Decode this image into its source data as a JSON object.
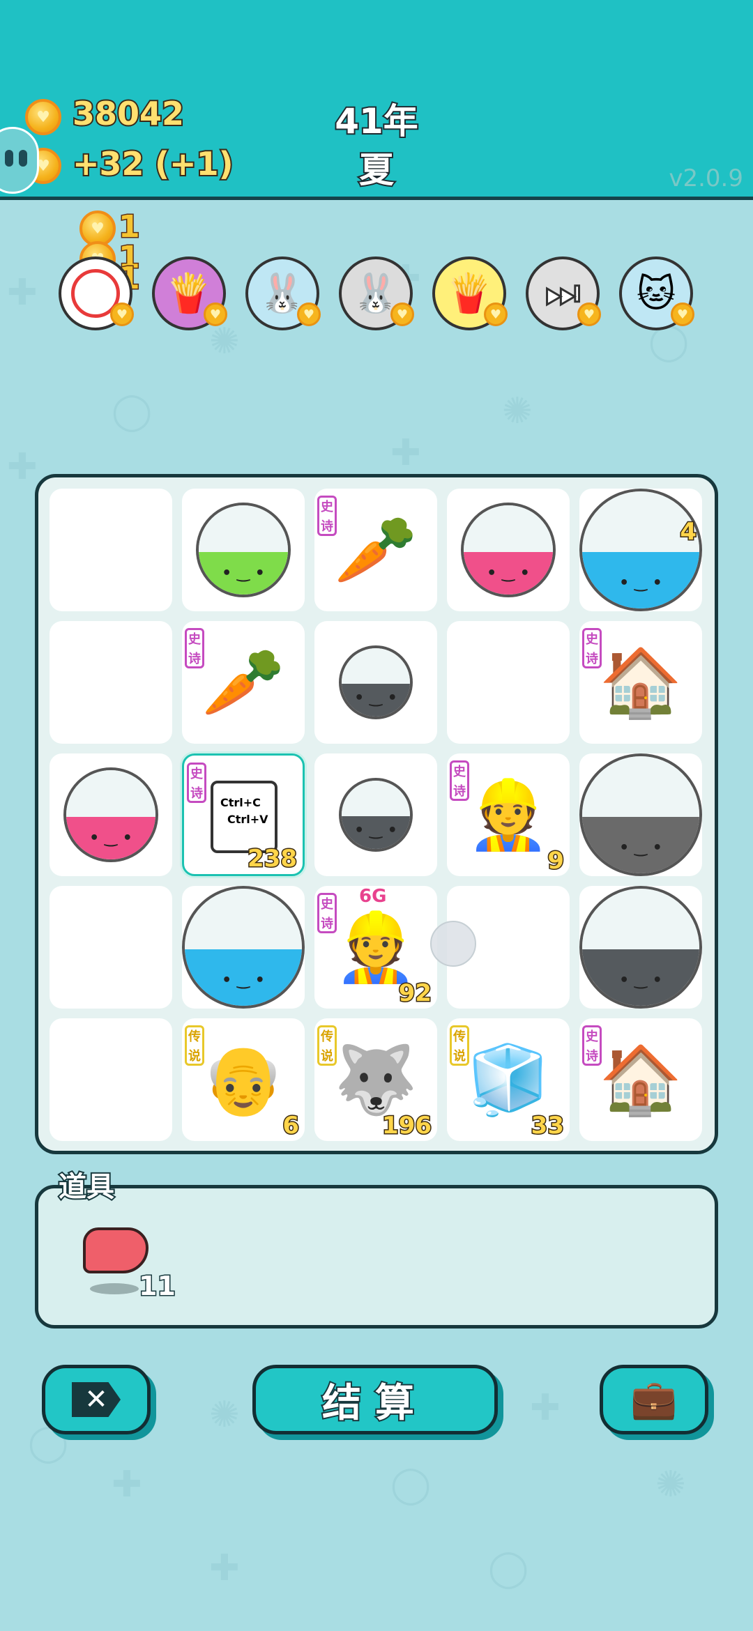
{
  "header": {
    "coins": "38042",
    "income": "+32",
    "income_bonus": "(+1)",
    "year": "41年",
    "season": "夏",
    "version": "v2.0.9"
  },
  "reward_stack": [
    "1",
    "1",
    "1"
  ],
  "rewards": [
    {
      "icon": "empty-target-icon",
      "bg": "#ffffff"
    },
    {
      "icon": "fries-icon",
      "bg": "#d07fd8"
    },
    {
      "icon": "rabbit-icon",
      "bg": "#bfe7f4"
    },
    {
      "icon": "rabbit-icon",
      "bg": "#dcdcdc"
    },
    {
      "icon": "fries-icon",
      "bg": "#fff07a"
    },
    {
      "icon": "skip-icon",
      "bg": "#e0e0e0"
    },
    {
      "icon": "cat-icon",
      "bg": "#bfe7f4"
    }
  ],
  "board": {
    "cells": [
      {
        "type": "empty"
      },
      {
        "type": "ball",
        "color": "#7fdc4a",
        "label": "x-ball"
      },
      {
        "type": "item",
        "icon": "carrot-icon",
        "emoji": "🥕",
        "tag": "史诗",
        "tag_kind": "epic"
      },
      {
        "type": "ball",
        "color": "#f0508a",
        "label": "cereal-ball"
      },
      {
        "type": "ball",
        "color": "#2fb8ec",
        "label": "multiplier-ball",
        "badge": "4",
        "big": true
      },
      {
        "type": "empty"
      },
      {
        "type": "item",
        "icon": "carrot-icon",
        "emoji": "🥕",
        "tag": "史诗",
        "tag_kind": "epic"
      },
      {
        "type": "ball",
        "color": "#555a5e",
        "label": "gacha-ball",
        "small": true
      },
      {
        "type": "empty"
      },
      {
        "type": "item",
        "icon": "rabbit-house-icon",
        "emoji": "🏠",
        "tag": "史诗",
        "tag_kind": "epic"
      },
      {
        "type": "ball",
        "color": "#f0508a",
        "label": "cereal-ball"
      },
      {
        "type": "item",
        "icon": "copy-paste-icon",
        "text1": "Ctrl+C",
        "text2": "Ctrl+V",
        "tag": "史诗",
        "tag_kind": "epic",
        "count": "238",
        "selected": true
      },
      {
        "type": "ball",
        "color": "#555a5e",
        "label": "gacha-ball",
        "small": true
      },
      {
        "type": "item",
        "icon": "worker-icon",
        "emoji": "👷",
        "tag": "史诗",
        "tag_kind": "epic",
        "count": "9"
      },
      {
        "type": "ball",
        "color": "#6a6a6a",
        "label": "big-gacha-ball",
        "big": true
      },
      {
        "type": "empty"
      },
      {
        "type": "ball",
        "color": "#2fb8ec",
        "label": "multiplier-ball",
        "big": true
      },
      {
        "type": "item",
        "icon": "worker-icon",
        "emoji": "👷",
        "tag": "史诗",
        "tag_kind": "epic",
        "count": "92",
        "label": "6G"
      },
      {
        "type": "empty",
        "ghost": true
      },
      {
        "type": "ball",
        "color": "#555a5e",
        "label": "gacha-ball",
        "big": true
      },
      {
        "type": "empty"
      },
      {
        "type": "item",
        "icon": "old-man-icon",
        "emoji": "👴",
        "tag": "传说",
        "tag_kind": "legend",
        "count": "6"
      },
      {
        "type": "item",
        "icon": "husky-king-icon",
        "emoji": "🐺",
        "tag": "传说",
        "tag_kind": "legend",
        "count": "196"
      },
      {
        "type": "item",
        "icon": "fridge-icon",
        "emoji": "🧊",
        "tag": "传说",
        "tag_kind": "legend",
        "count": "33"
      },
      {
        "type": "item",
        "icon": "rabbit-house-icon",
        "emoji": "🏠",
        "tag": "史诗",
        "tag_kind": "epic"
      }
    ]
  },
  "items": {
    "title": "道具",
    "list": [
      {
        "icon": "liver-icon",
        "count": "11"
      }
    ]
  },
  "buttons": {
    "remove": "remove-icon",
    "settle": "结算",
    "bag": "briefcase-icon"
  }
}
